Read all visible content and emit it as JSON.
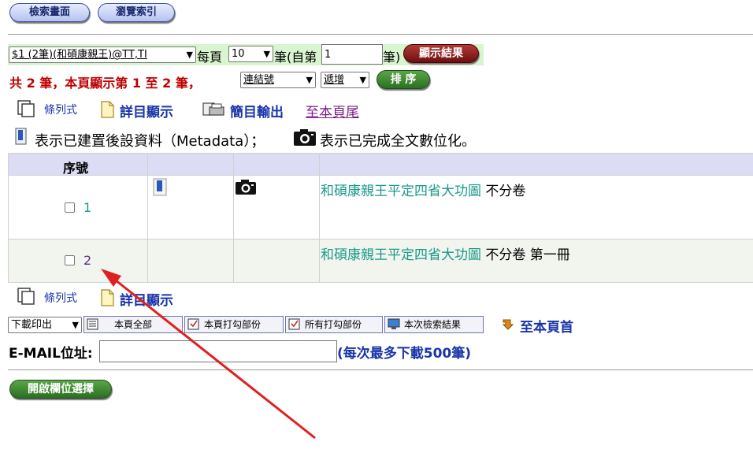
{
  "top_buttons": {
    "search": "檢索畫面",
    "browse": "瀏覽索引"
  },
  "result_bar": {
    "query_select": "$1 (2筆)(和碩康親王)@TT,TI",
    "per_page_label": "每頁",
    "per_page_value": "10",
    "records_from_label": "筆(自第",
    "start_value": "1",
    "records_suffix": "筆)",
    "show_button": "顯示結果"
  },
  "summary": {
    "text": "共 2 筆，本頁顯示第 1 至 2 筆，",
    "sort_field": "連結號",
    "sort_order": "遞增",
    "sort_button": "排 序"
  },
  "view_links": {
    "list": "條列式",
    "detail": "詳目顯示",
    "brief_output": "簡目輸出",
    "to_bottom": "至本頁尾"
  },
  "legend": {
    "metadata": "表示已建置後設資料（Metadata）；",
    "digitized": "表示已完成全文數位化。"
  },
  "table": {
    "header_seq": "序號",
    "rows": [
      {
        "num": "1",
        "title_link": "和碩康親王平定四省大功圖",
        "title_rest": "不分卷"
      },
      {
        "num": "2",
        "title_link": "和碩康親王平定四省大功圖",
        "title_rest": "不分卷 第一冊"
      }
    ]
  },
  "bottom_links": {
    "list": "條列式",
    "detail": "詳目顯示"
  },
  "download": {
    "mode_select": "下載印出",
    "page_all": "本頁全部",
    "page_checked": "本頁打勾部份",
    "all_checked": "所有打勾部份",
    "this_search": "本次檢索結果",
    "to_top": "至本頁首"
  },
  "email": {
    "label": "E-MAIL位址:",
    "value": "",
    "note": "(每次最多下載500筆)"
  },
  "field_button": "開啟欄位選擇",
  "colors": {
    "annotation_arrow": "#e02020",
    "link_teal": "#1a9a8a",
    "header_bg": "#dcdcf5"
  }
}
